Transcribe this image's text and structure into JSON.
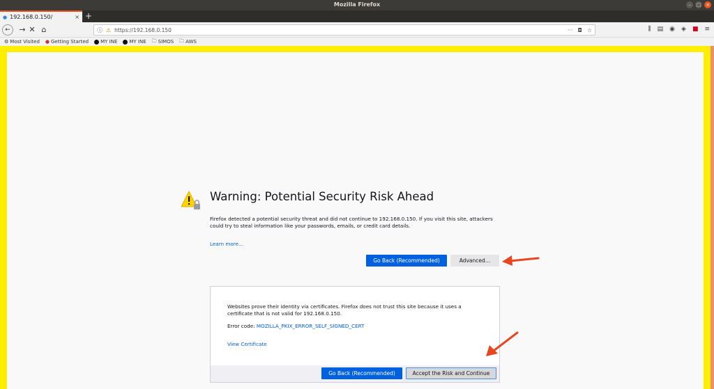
{
  "window": {
    "title": "Mozilla Firefox",
    "buttons": [
      "–",
      "□",
      "×"
    ]
  },
  "tab": {
    "title": "192.168.0.150/",
    "close": "×",
    "new_tab": "+"
  },
  "nav": {
    "back": "←",
    "forward": "→",
    "stop": "✕",
    "home": "⌂"
  },
  "url": {
    "value": "https://192.168.0.150",
    "page_actions": "···"
  },
  "bookmarks": [
    {
      "label": "Most Visited",
      "icon": "gear-icon"
    },
    {
      "label": "Getting Started",
      "icon": "firefox-icon"
    },
    {
      "label": "MY INE",
      "icon": "ine-icon"
    },
    {
      "label": "MY INE",
      "icon": "ine-icon"
    },
    {
      "label": "SIMOS",
      "icon": "folder-icon"
    },
    {
      "label": "AWS",
      "icon": "folder-icon"
    }
  ],
  "warning": {
    "heading": "Warning: Potential Security Risk Ahead",
    "description": "Firefox detected a potential security threat and did not continue to 192.168.0.150. If you visit this site, attackers could try to steal information like your passwords, emails, or credit card details.",
    "learn_more": "Learn more…",
    "go_back": "Go Back (Recommended)",
    "advanced": "Advanced…"
  },
  "advanced_panel": {
    "text": "Websites prove their identity via certificates. Firefox does not trust this site because it uses a certificate that is not valid for 192.168.0.150.",
    "error_label": "Error code: ",
    "error_code": "MOZILLA_PKIX_ERROR_SELF_SIGNED_CERT",
    "view_certificate": "View Certificate",
    "go_back": "Go Back (Recommended)",
    "accept": "Accept the Risk and Continue"
  },
  "colors": {
    "highlight_frame": "#ffee00",
    "annotation_arrow": "#e8461e",
    "primary_button": "#0061e0"
  }
}
